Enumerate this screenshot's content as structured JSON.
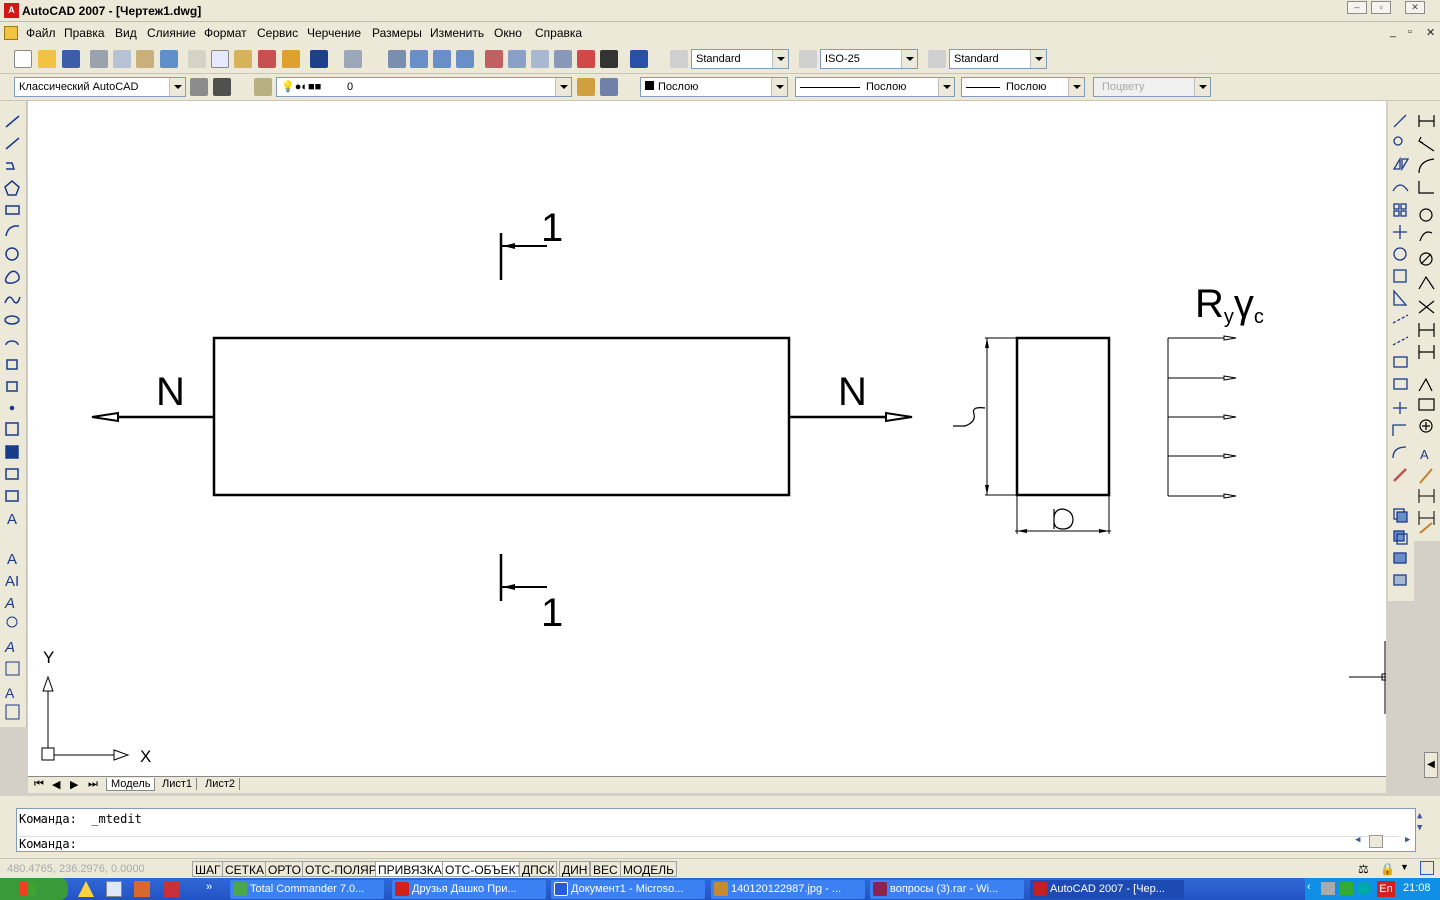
{
  "window": {
    "title": "AutoCAD 2007 - [Чертеж1.dwg]",
    "minimize": "–",
    "restore": "▫",
    "close": "✕"
  },
  "menu": [
    "Файл",
    "Правка",
    "Вид",
    "Слияние",
    "Формат",
    "Сервис",
    "Черчение",
    "Размеры",
    "Изменить",
    "Окно",
    "Справка"
  ],
  "styles_toolbar": {
    "text_style": "Standard",
    "dim_style": "ISO-25",
    "table_style": "Standard"
  },
  "layers_toolbar": {
    "workspace": "Классический AutoCAD",
    "layer": "0",
    "color": "Послою",
    "linetype": "Послою",
    "lineweight": "Послою",
    "plotstyle": "Поцвету"
  },
  "drawing": {
    "section_label_top": "1",
    "section_label_bottom": "1",
    "force_left": "N",
    "force_right": "N",
    "stress_R": "R",
    "stress_R_sub": "y",
    "stress_gamma": "γ",
    "stress_gamma_sub": "c",
    "ucs_y": "Y",
    "ucs_x": "X"
  },
  "layout_tabs": [
    "Модель",
    "Лист1",
    "Лист2"
  ],
  "command": {
    "line1": "Команда:  _mtedit",
    "line2": "Команда:"
  },
  "status": {
    "coords": "480.4765, 236.2976, 0.0000",
    "buttons": [
      "ШАГ",
      "СЕТКА",
      "ОРТО",
      "ОТС-ПОЛЯР",
      "ПРИВЯЗКА",
      "ОТС-ОБЪЕКТ",
      "ДПСК",
      "ДИН",
      "ВЕС",
      "МОДЕЛЬ"
    ]
  },
  "taskbar": {
    "tasks": [
      {
        "label": "Total Commander 7.0...",
        "color": "#4ca64c"
      },
      {
        "label": "Друзья Дашко При...",
        "color": "#d02020"
      },
      {
        "label": "Документ1 - Microso...",
        "color": "#2a5bd7"
      },
      {
        "label": "140120122987.jpg - ...",
        "color": "#c88a30"
      },
      {
        "label": "вопросы (3).rar - Wi...",
        "color": "#8b2252"
      },
      {
        "label": "AutoCAD 2007 - [Чер...",
        "color": "#c02020"
      }
    ],
    "lang": "En",
    "clock": "21:08"
  }
}
